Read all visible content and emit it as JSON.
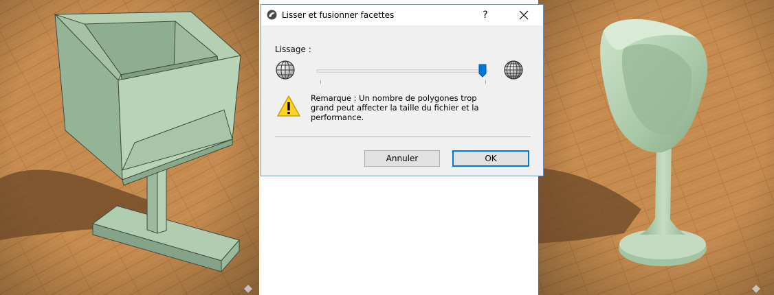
{
  "dialog": {
    "title": "Lisser et fusionner facettes",
    "help_label": "?",
    "smoothing_label": "Lissage :",
    "slider_level": 1.0,
    "note_lines": [
      "Remarque : Un nombre de polygones trop",
      "grand peut affecter la taille du fichier et la",
      "performance."
    ],
    "cancel_label": "Annuler",
    "ok_label": "OK"
  },
  "icons": [
    "app-icon",
    "close-icon",
    "globe-low-icon",
    "globe-high-icon",
    "warning-icon"
  ],
  "colors": {
    "floor": "#c48a4e",
    "model": "#a6c6a8",
    "accent": "#0078d7",
    "warning": "#ffd21f"
  }
}
